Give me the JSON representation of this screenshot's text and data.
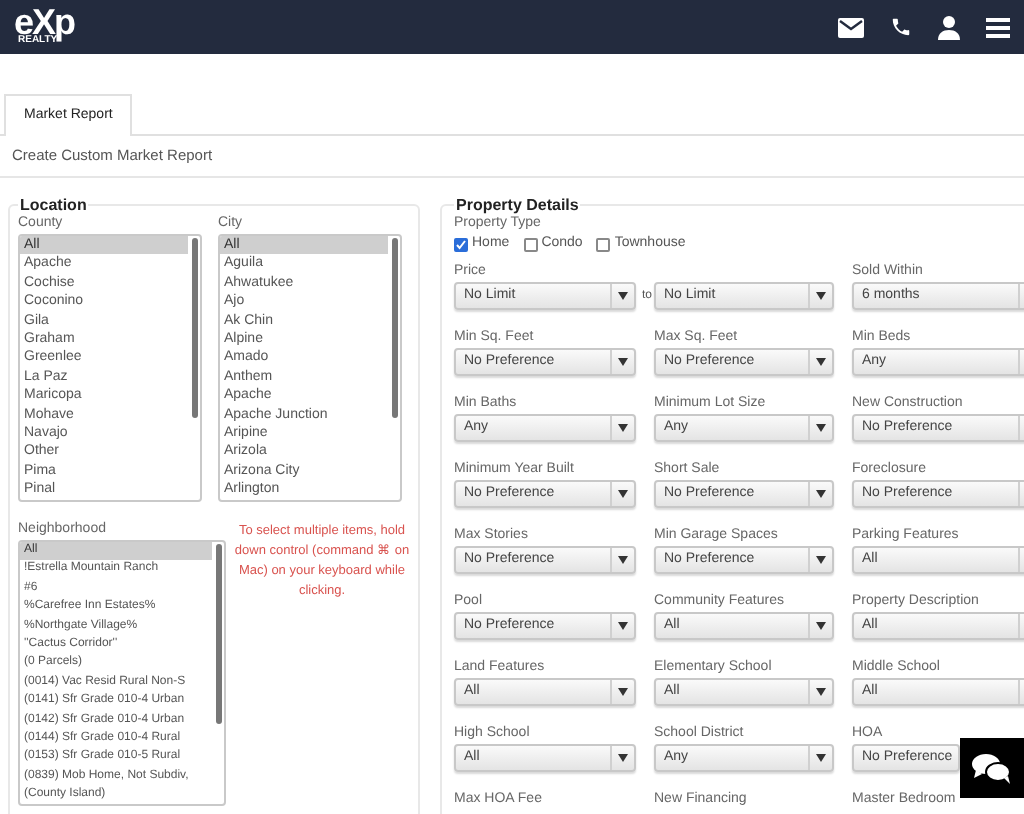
{
  "header": {
    "logo": "eXp",
    "logo_sub": "REALTY"
  },
  "tabs": [
    {
      "label": "Market Report",
      "selected": true
    }
  ],
  "page_title": "Create Custom Market Report",
  "location": {
    "legend": "Location",
    "county": {
      "label": "County",
      "items": [
        {
          "text": "All",
          "selected": true
        },
        {
          "text": "Apache",
          "selected": false
        },
        {
          "text": "Cochise",
          "selected": false
        },
        {
          "text": "Coconino",
          "selected": false
        },
        {
          "text": "Gila",
          "selected": false
        },
        {
          "text": "Graham",
          "selected": false
        },
        {
          "text": "Greenlee",
          "selected": false
        },
        {
          "text": "La Paz",
          "selected": false
        },
        {
          "text": "Maricopa",
          "selected": false
        },
        {
          "text": "Mohave",
          "selected": false
        },
        {
          "text": "Navajo",
          "selected": false
        },
        {
          "text": "Other",
          "selected": false
        },
        {
          "text": "Pima",
          "selected": false
        },
        {
          "text": "Pinal",
          "selected": false
        }
      ]
    },
    "city": {
      "label": "City",
      "items": [
        {
          "text": "All",
          "selected": true
        },
        {
          "text": "Aguila",
          "selected": false
        },
        {
          "text": "Ahwatukee",
          "selected": false
        },
        {
          "text": "Ajo",
          "selected": false
        },
        {
          "text": "Ak Chin",
          "selected": false
        },
        {
          "text": "Alpine",
          "selected": false
        },
        {
          "text": "Amado",
          "selected": false
        },
        {
          "text": "Anthem",
          "selected": false
        },
        {
          "text": "Apache",
          "selected": false
        },
        {
          "text": "Apache Junction",
          "selected": false
        },
        {
          "text": "Aripine",
          "selected": false
        },
        {
          "text": "Arizola",
          "selected": false
        },
        {
          "text": "Arizona City",
          "selected": false
        },
        {
          "text": "Arlington",
          "selected": false
        }
      ]
    },
    "neighborhood": {
      "label": "Neighborhood",
      "items": [
        {
          "text": "All",
          "selected": true
        },
        {
          "text": "!Estrella Mountain Ranch",
          "selected": false
        },
        {
          "text": "#6",
          "selected": false
        },
        {
          "text": "%Carefree Inn Estates%",
          "selected": false
        },
        {
          "text": "%Northgate Village%",
          "selected": false
        },
        {
          "text": "''Cactus Corridor''",
          "selected": false
        },
        {
          "text": "(0 Parcels)",
          "selected": false
        },
        {
          "text": "(0014) Vac Resid Rural Non-S",
          "selected": false
        },
        {
          "text": "(0141) Sfr Grade 010-4 Urban",
          "selected": false
        },
        {
          "text": "(0142) Sfr Grade 010-4 Urban",
          "selected": false
        },
        {
          "text": "(0144) Sfr Grade 010-4 Rural",
          "selected": false
        },
        {
          "text": "(0153) Sfr Grade 010-5 Rural",
          "selected": false
        },
        {
          "text": "(0839) Mob Home, Not Subdiv,",
          "selected": false
        },
        {
          "text": "(County Island)",
          "selected": false
        }
      ]
    },
    "hint": "To select multiple items, hold down control (command ⌘ on Mac) on your keyboard while clicking."
  },
  "property": {
    "legend": "Property Details",
    "type_label": "Property Type",
    "types": [
      {
        "label": "Home",
        "checked": true
      },
      {
        "label": "Condo",
        "checked": false
      },
      {
        "label": "Townhouse",
        "checked": false
      }
    ],
    "rows": [
      [
        {
          "kind": "range_from",
          "label": "Price",
          "value": "No Limit",
          "to": "to"
        },
        {
          "kind": "range_to",
          "value": "No Limit"
        },
        {
          "kind": "select",
          "label": "Sold Within",
          "value": "6 months"
        }
      ],
      [
        {
          "kind": "select",
          "label": "Min Sq. Feet",
          "value": "No Preference"
        },
        {
          "kind": "select",
          "label": "Max Sq. Feet",
          "value": "No Preference"
        },
        {
          "kind": "select",
          "label": "Min Beds",
          "value": "Any"
        }
      ],
      [
        {
          "kind": "select",
          "label": "Min Baths",
          "value": "Any"
        },
        {
          "kind": "select",
          "label": "Minimum Lot Size",
          "value": "Any"
        },
        {
          "kind": "select",
          "label": "New Construction",
          "value": "No Preference"
        }
      ],
      [
        {
          "kind": "select",
          "label": "Minimum Year Built",
          "value": "No Preference"
        },
        {
          "kind": "select",
          "label": "Short Sale",
          "value": "No Preference"
        },
        {
          "kind": "select",
          "label": "Foreclosure",
          "value": "No Preference"
        }
      ],
      [
        {
          "kind": "select",
          "label": "Max Stories",
          "value": "No Preference"
        },
        {
          "kind": "select",
          "label": "Min Garage Spaces",
          "value": "No Preference"
        },
        {
          "kind": "select",
          "label": "Parking Features",
          "value": "All"
        }
      ],
      [
        {
          "kind": "select",
          "label": "Pool",
          "value": "No Preference"
        },
        {
          "kind": "select",
          "label": "Community Features",
          "value": "All"
        },
        {
          "kind": "select",
          "label": "Property Description",
          "value": "All"
        }
      ],
      [
        {
          "kind": "select",
          "label": "Land Features",
          "value": "All"
        },
        {
          "kind": "select",
          "label": "Elementary School",
          "value": "All"
        },
        {
          "kind": "select",
          "label": "Middle School",
          "value": "All"
        }
      ],
      [
        {
          "kind": "select",
          "label": "High School",
          "value": "All"
        },
        {
          "kind": "select",
          "label": "School District",
          "value": "Any"
        },
        {
          "kind": "select",
          "label": "HOA",
          "value": "No Preference"
        }
      ],
      [
        {
          "kind": "label",
          "label": "Max HOA Fee"
        },
        {
          "kind": "label",
          "label": "New Financing"
        },
        {
          "kind": "label",
          "label": "Master Bedroom"
        }
      ]
    ]
  }
}
